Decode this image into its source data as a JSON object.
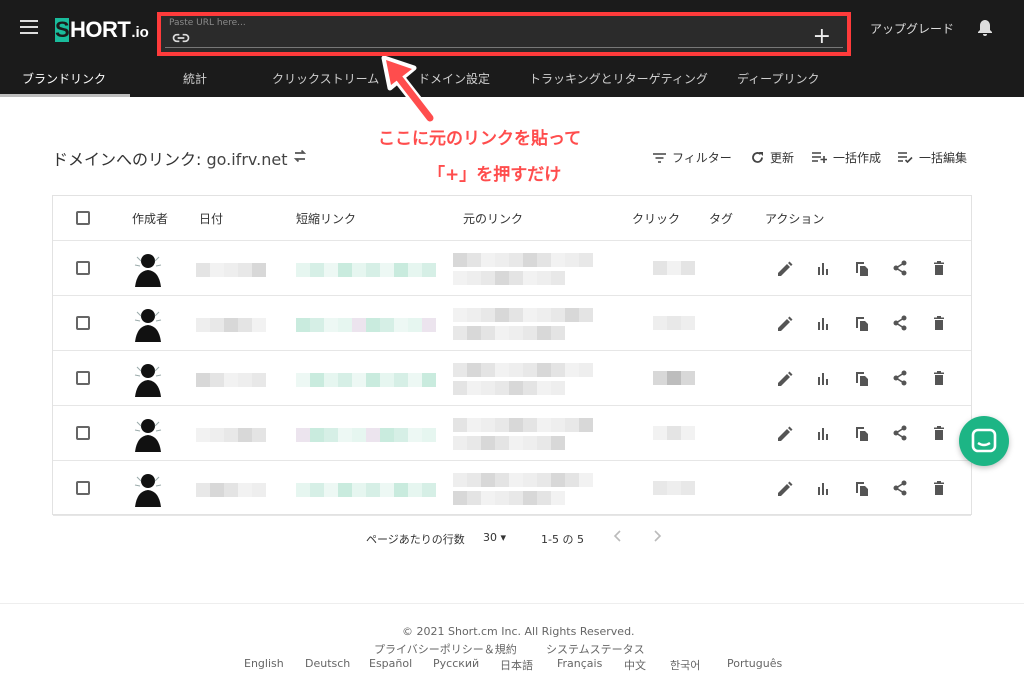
{
  "topbar": {
    "logo_mark": "S",
    "logo_word": "HORT",
    "logo_tld": ".io",
    "url_label": "Paste URL here...",
    "url_value": "",
    "plus_label": "+",
    "upgrade_label": "アップグレード"
  },
  "tabs": [
    {
      "label": "ブランドリンク",
      "active": true
    },
    {
      "label": "統計"
    },
    {
      "label": "クリックストリーム"
    },
    {
      "label": "ドメイン設定"
    },
    {
      "label": "トラッキングとリターゲティング"
    },
    {
      "label": "ディープリンク"
    }
  ],
  "annotation": {
    "line1": "ここに元のリンクを貼って",
    "line2": "「+」を押すだけ",
    "color": "#ff4d4d"
  },
  "header": {
    "title_prefix": "ドメインへのリンク: ",
    "domain": "go.ifrv.net",
    "filter_label": "フィルター",
    "refresh_label": "更新",
    "bulk_create_label": "一括作成",
    "bulk_edit_label": "一括編集"
  },
  "table": {
    "columns": [
      "作成者",
      "日付",
      "短縮リンク",
      "元のリンク",
      "クリック",
      "タグ",
      "アクション"
    ],
    "row_count": 5
  },
  "pagination": {
    "rows_label": "ページあたりの行数",
    "rows_value": "30",
    "range_label": "1-5 の 5"
  },
  "footer": {
    "copyright": "© 2021  Short.cm Inc. All Rights Reserved.",
    "privacy": "プライバシーポリシー＆規約",
    "status": "システムステータス",
    "languages": [
      "English",
      "Deutsch",
      "Español",
      "Русский",
      "日本語",
      "Français",
      "中文",
      "한국어",
      "Português"
    ]
  },
  "colors": {
    "topbar": "#1b1b1b",
    "brand": "#1abc9c",
    "highlight": "#ff3b3b",
    "chat": "#1db585"
  }
}
